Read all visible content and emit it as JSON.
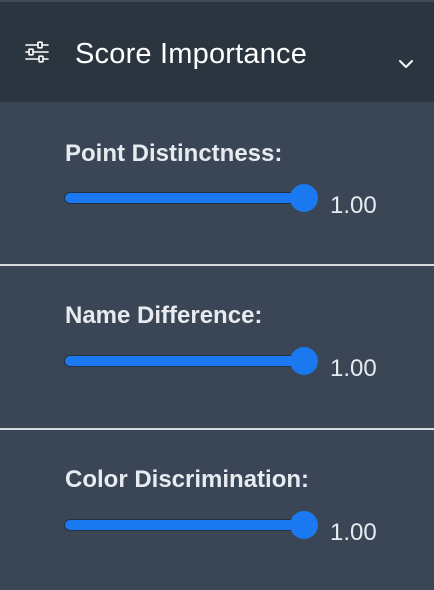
{
  "header": {
    "title": "Score Importance",
    "icon": "sliders-icon",
    "toggle_icon": "chevron-down-icon"
  },
  "colors": {
    "header_bg": "#2b3540",
    "panel_bg": "#3a4655",
    "accent": "#1a79f0",
    "divider": "#d7dbe0"
  },
  "controls": [
    {
      "label": "Point Distinctness:",
      "value": "1.00",
      "level": 1.0
    },
    {
      "label": "Name Difference:",
      "value": "1.00",
      "level": 1.0
    },
    {
      "label": "Color Discrimination:",
      "value": "1.00",
      "level": 1.0
    }
  ]
}
